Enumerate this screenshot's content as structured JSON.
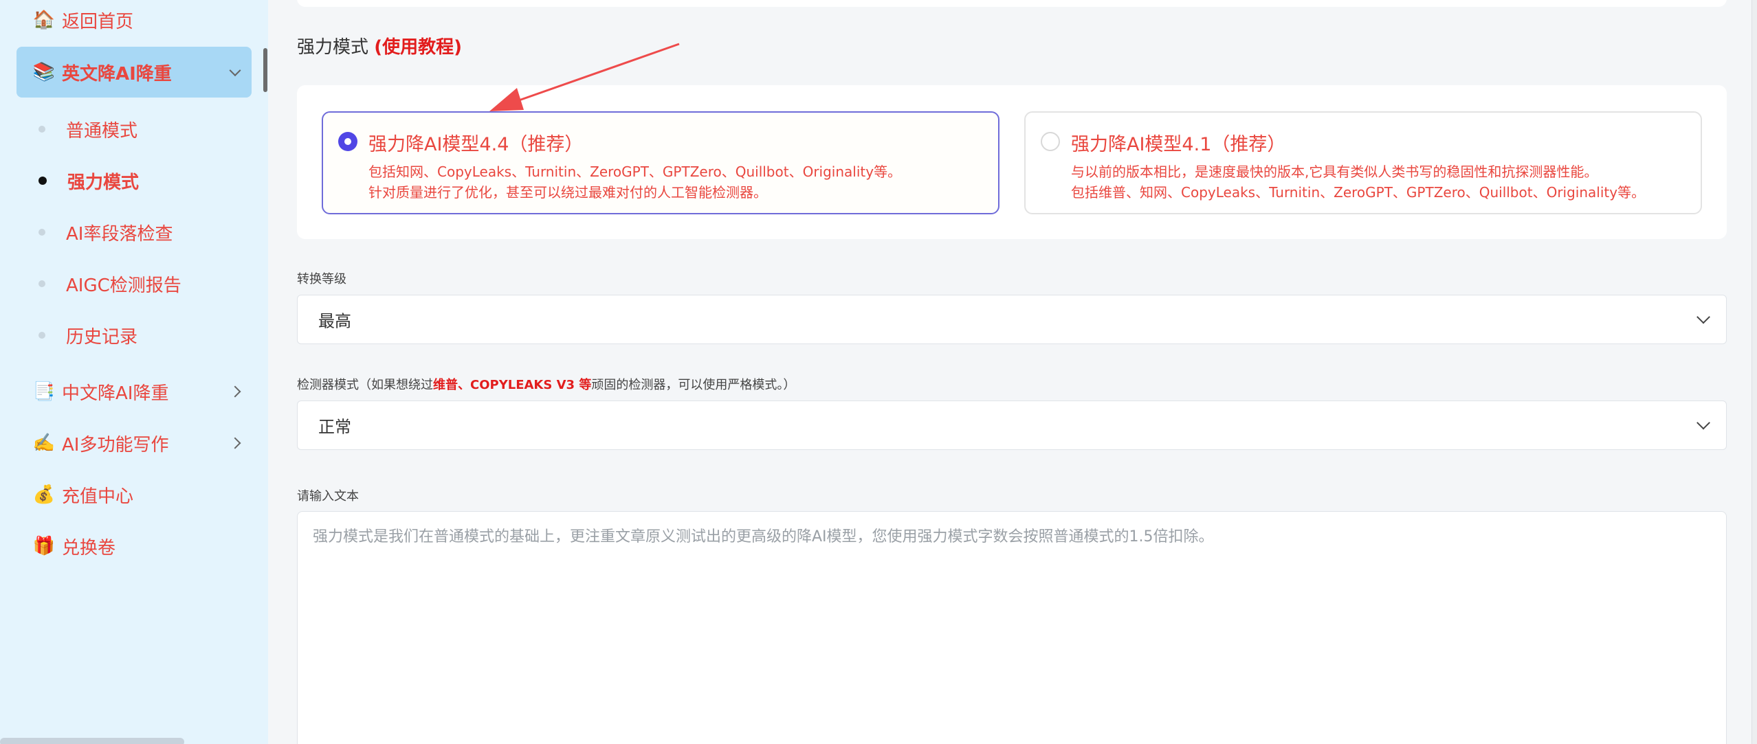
{
  "sidebar": {
    "items": [
      {
        "icon": "house-icon",
        "emoji": "🏠",
        "label": "返回首页"
      },
      {
        "icon": "books-icon",
        "emoji": "📚",
        "label": "英文降AI降重"
      },
      {
        "icon": "document-icon",
        "emoji": "📑",
        "label": "中文降AI降重"
      },
      {
        "icon": "writing-hand-icon",
        "emoji": "✍️",
        "label": "AI多功能写作"
      },
      {
        "icon": "money-bag-icon",
        "emoji": "💰",
        "label": "充值中心"
      },
      {
        "icon": "gift-icon",
        "emoji": "🎁",
        "label": "兑换卷"
      }
    ],
    "sub_items": [
      "普通模式",
      "强力模式",
      "AI率段落检查",
      "AIGC检测报告",
      "历史记录"
    ]
  },
  "main": {
    "title": "强力模式",
    "tutorial_link": "(使用教程)",
    "options": [
      {
        "title": "强力降AI模型4.4（推荐）",
        "line1": "包括知网、CopyLeaks、Turnitin、ZeroGPT、GPTZero、Quillbot、Originality等。",
        "line2": "针对质量进行了优化，甚至可以绕过最难对付的人工智能检测器。"
      },
      {
        "title": "强力降AI模型4.1（推荐）",
        "line1": "与以前的版本相比，是速度最快的版本,它具有类似人类书写的稳固性和抗探测器性能。",
        "line2": "包括维普、知网、CopyLeaks、Turnitin、ZeroGPT、GPTZero、Quillbot、Originality等。"
      }
    ],
    "level_label": "转换等级",
    "level_value": "最高",
    "detector_label_pre": "检测器模式（如果想绕过",
    "detector_label_hl": "维普、COPYLEAKS V3 等",
    "detector_label_post": "顽固的检测器，可以使用严格模式。）",
    "detector_value": "正常",
    "input_label": "请输入文本",
    "input_placeholder": "强力模式是我们在普通模式的基础上，更注重文章原义测试出的更高级的降AI模型，您使用强力模式字数会按照普通模式的1.5倍扣除。"
  },
  "colors": {
    "accent_red": "#e9473f",
    "link_red": "#e21d1d",
    "radio_purple": "#5046e5",
    "sidebar_bg": "#e4f4fd",
    "active_item_bg": "#a8d8f5"
  }
}
